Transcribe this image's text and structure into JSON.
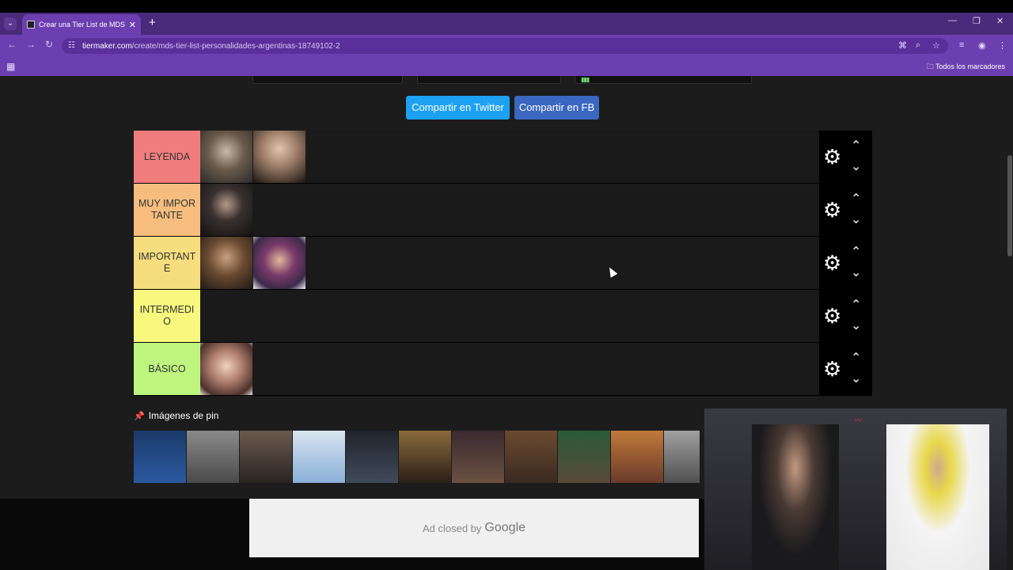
{
  "browser": {
    "tab_title": "Crear una Tier List de MDS Pers",
    "url_domain": "tiermaker.com",
    "url_path": "/create/mds-tier-list-personalidades-argentinas-18749102-2",
    "bookmarks_label": "Todos los marcadores"
  },
  "share": {
    "twitter_label": "Compartir en Twitter",
    "facebook_label": "Compartir en FB"
  },
  "tiers": [
    {
      "label": "LEYENDA",
      "color": "#f07c7c"
    },
    {
      "label": "MUY IMPORTANTE",
      "color": "#f6bd7e"
    },
    {
      "label": "IMPORTANTE",
      "color": "#f6dd7e"
    },
    {
      "label": "INTERMEDIO",
      "color": "#f8f87e"
    },
    {
      "label": "BÁSICO",
      "color": "#bdf57e"
    }
  ],
  "pin": {
    "title": "Imágenes de pin"
  },
  "ad": {
    "closed_by": "Ad closed by",
    "google": "Google"
  }
}
